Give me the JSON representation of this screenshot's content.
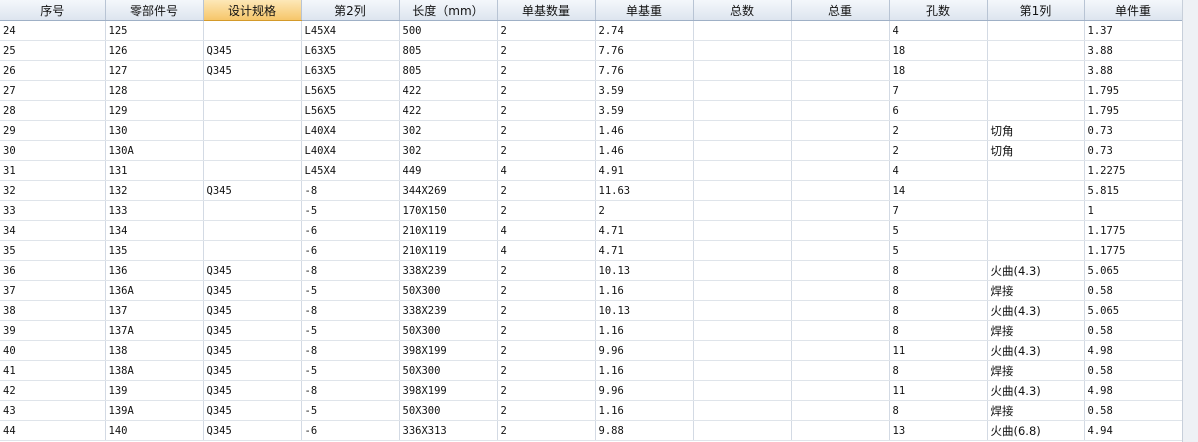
{
  "grid": {
    "columns": [
      "序号",
      "零部件号",
      "设计规格",
      "第2列",
      "长度（mm）",
      "单基数量",
      "单基重",
      "总数",
      "总重",
      "孔数",
      "第1列",
      "单件重"
    ],
    "selected_column": 2,
    "rows": [
      [
        "24",
        "125",
        "",
        "L45X4",
        "500",
        "2",
        "2.74",
        "",
        "",
        "4",
        "",
        "1.37"
      ],
      [
        "25",
        "126",
        "Q345",
        "L63X5",
        "805",
        "2",
        "7.76",
        "",
        "",
        "18",
        "",
        "3.88"
      ],
      [
        "26",
        "127",
        "Q345",
        "L63X5",
        "805",
        "2",
        "7.76",
        "",
        "",
        "18",
        "",
        "3.88"
      ],
      [
        "27",
        "128",
        "",
        "L56X5",
        "422",
        "2",
        "3.59",
        "",
        "",
        "7",
        "",
        "1.795"
      ],
      [
        "28",
        "129",
        "",
        "L56X5",
        "422",
        "2",
        "3.59",
        "",
        "",
        "6",
        "",
        "1.795"
      ],
      [
        "29",
        "130",
        "",
        "L40X4",
        "302",
        "2",
        "1.46",
        "",
        "",
        "2",
        "切角",
        "0.73"
      ],
      [
        "30",
        "130A",
        "",
        "L40X4",
        "302",
        "2",
        "1.46",
        "",
        "",
        "2",
        "切角",
        "0.73"
      ],
      [
        "31",
        "131",
        "",
        "L45X4",
        "449",
        "4",
        "4.91",
        "",
        "",
        "4",
        "",
        "1.2275"
      ],
      [
        "32",
        "132",
        "Q345",
        "-8",
        "344X269",
        "2",
        "11.63",
        "",
        "",
        "14",
        "",
        "5.815"
      ],
      [
        "33",
        "133",
        "",
        "-5",
        "170X150",
        "2",
        "2",
        "",
        "",
        "7",
        "",
        "1"
      ],
      [
        "34",
        "134",
        "",
        "-6",
        "210X119",
        "4",
        "4.71",
        "",
        "",
        "5",
        "",
        "1.1775"
      ],
      [
        "35",
        "135",
        "",
        "-6",
        "210X119",
        "4",
        "4.71",
        "",
        "",
        "5",
        "",
        "1.1775"
      ],
      [
        "36",
        "136",
        "Q345",
        "-8",
        "338X239",
        "2",
        "10.13",
        "",
        "",
        "8",
        "火曲(4.3)",
        "5.065"
      ],
      [
        "37",
        "136A",
        "Q345",
        "-5",
        "50X300",
        "2",
        "1.16",
        "",
        "",
        "8",
        "焊接",
        "0.58"
      ],
      [
        "38",
        "137",
        "Q345",
        "-8",
        "338X239",
        "2",
        "10.13",
        "",
        "",
        "8",
        "火曲(4.3)",
        "5.065"
      ],
      [
        "39",
        "137A",
        "Q345",
        "-5",
        "50X300",
        "2",
        "1.16",
        "",
        "",
        "8",
        "焊接",
        "0.58"
      ],
      [
        "40",
        "138",
        "Q345",
        "-8",
        "398X199",
        "2",
        "9.96",
        "",
        "",
        "11",
        "火曲(4.3)",
        "4.98"
      ],
      [
        "41",
        "138A",
        "Q345",
        "-5",
        "50X300",
        "2",
        "1.16",
        "",
        "",
        "8",
        "焊接",
        "0.58"
      ],
      [
        "42",
        "139",
        "Q345",
        "-8",
        "398X199",
        "2",
        "9.96",
        "",
        "",
        "11",
        "火曲(4.3)",
        "4.98"
      ],
      [
        "43",
        "139A",
        "Q345",
        "-5",
        "50X300",
        "2",
        "1.16",
        "",
        "",
        "8",
        "焊接",
        "0.58"
      ],
      [
        "44",
        "140",
        "Q345",
        "-6",
        "336X313",
        "2",
        "9.88",
        "",
        "",
        "13",
        "火曲(6.8)",
        "4.94"
      ]
    ]
  }
}
